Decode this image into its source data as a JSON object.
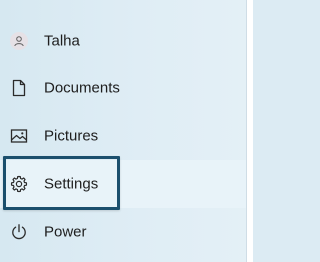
{
  "start_menu": {
    "items": [
      {
        "id": "user",
        "label": "Talha",
        "icon": "user-icon"
      },
      {
        "id": "documents",
        "label": "Documents",
        "icon": "document-icon"
      },
      {
        "id": "pictures",
        "label": "Pictures",
        "icon": "pictures-icon"
      },
      {
        "id": "settings",
        "label": "Settings",
        "icon": "gear-icon",
        "highlighted": true
      },
      {
        "id": "power",
        "label": "Power",
        "icon": "power-icon"
      }
    ]
  },
  "colors": {
    "background": "#dcebf3",
    "highlight_border": "#1b4f6d",
    "text": "#1e1e1e",
    "icon": "#2b2b2b"
  }
}
